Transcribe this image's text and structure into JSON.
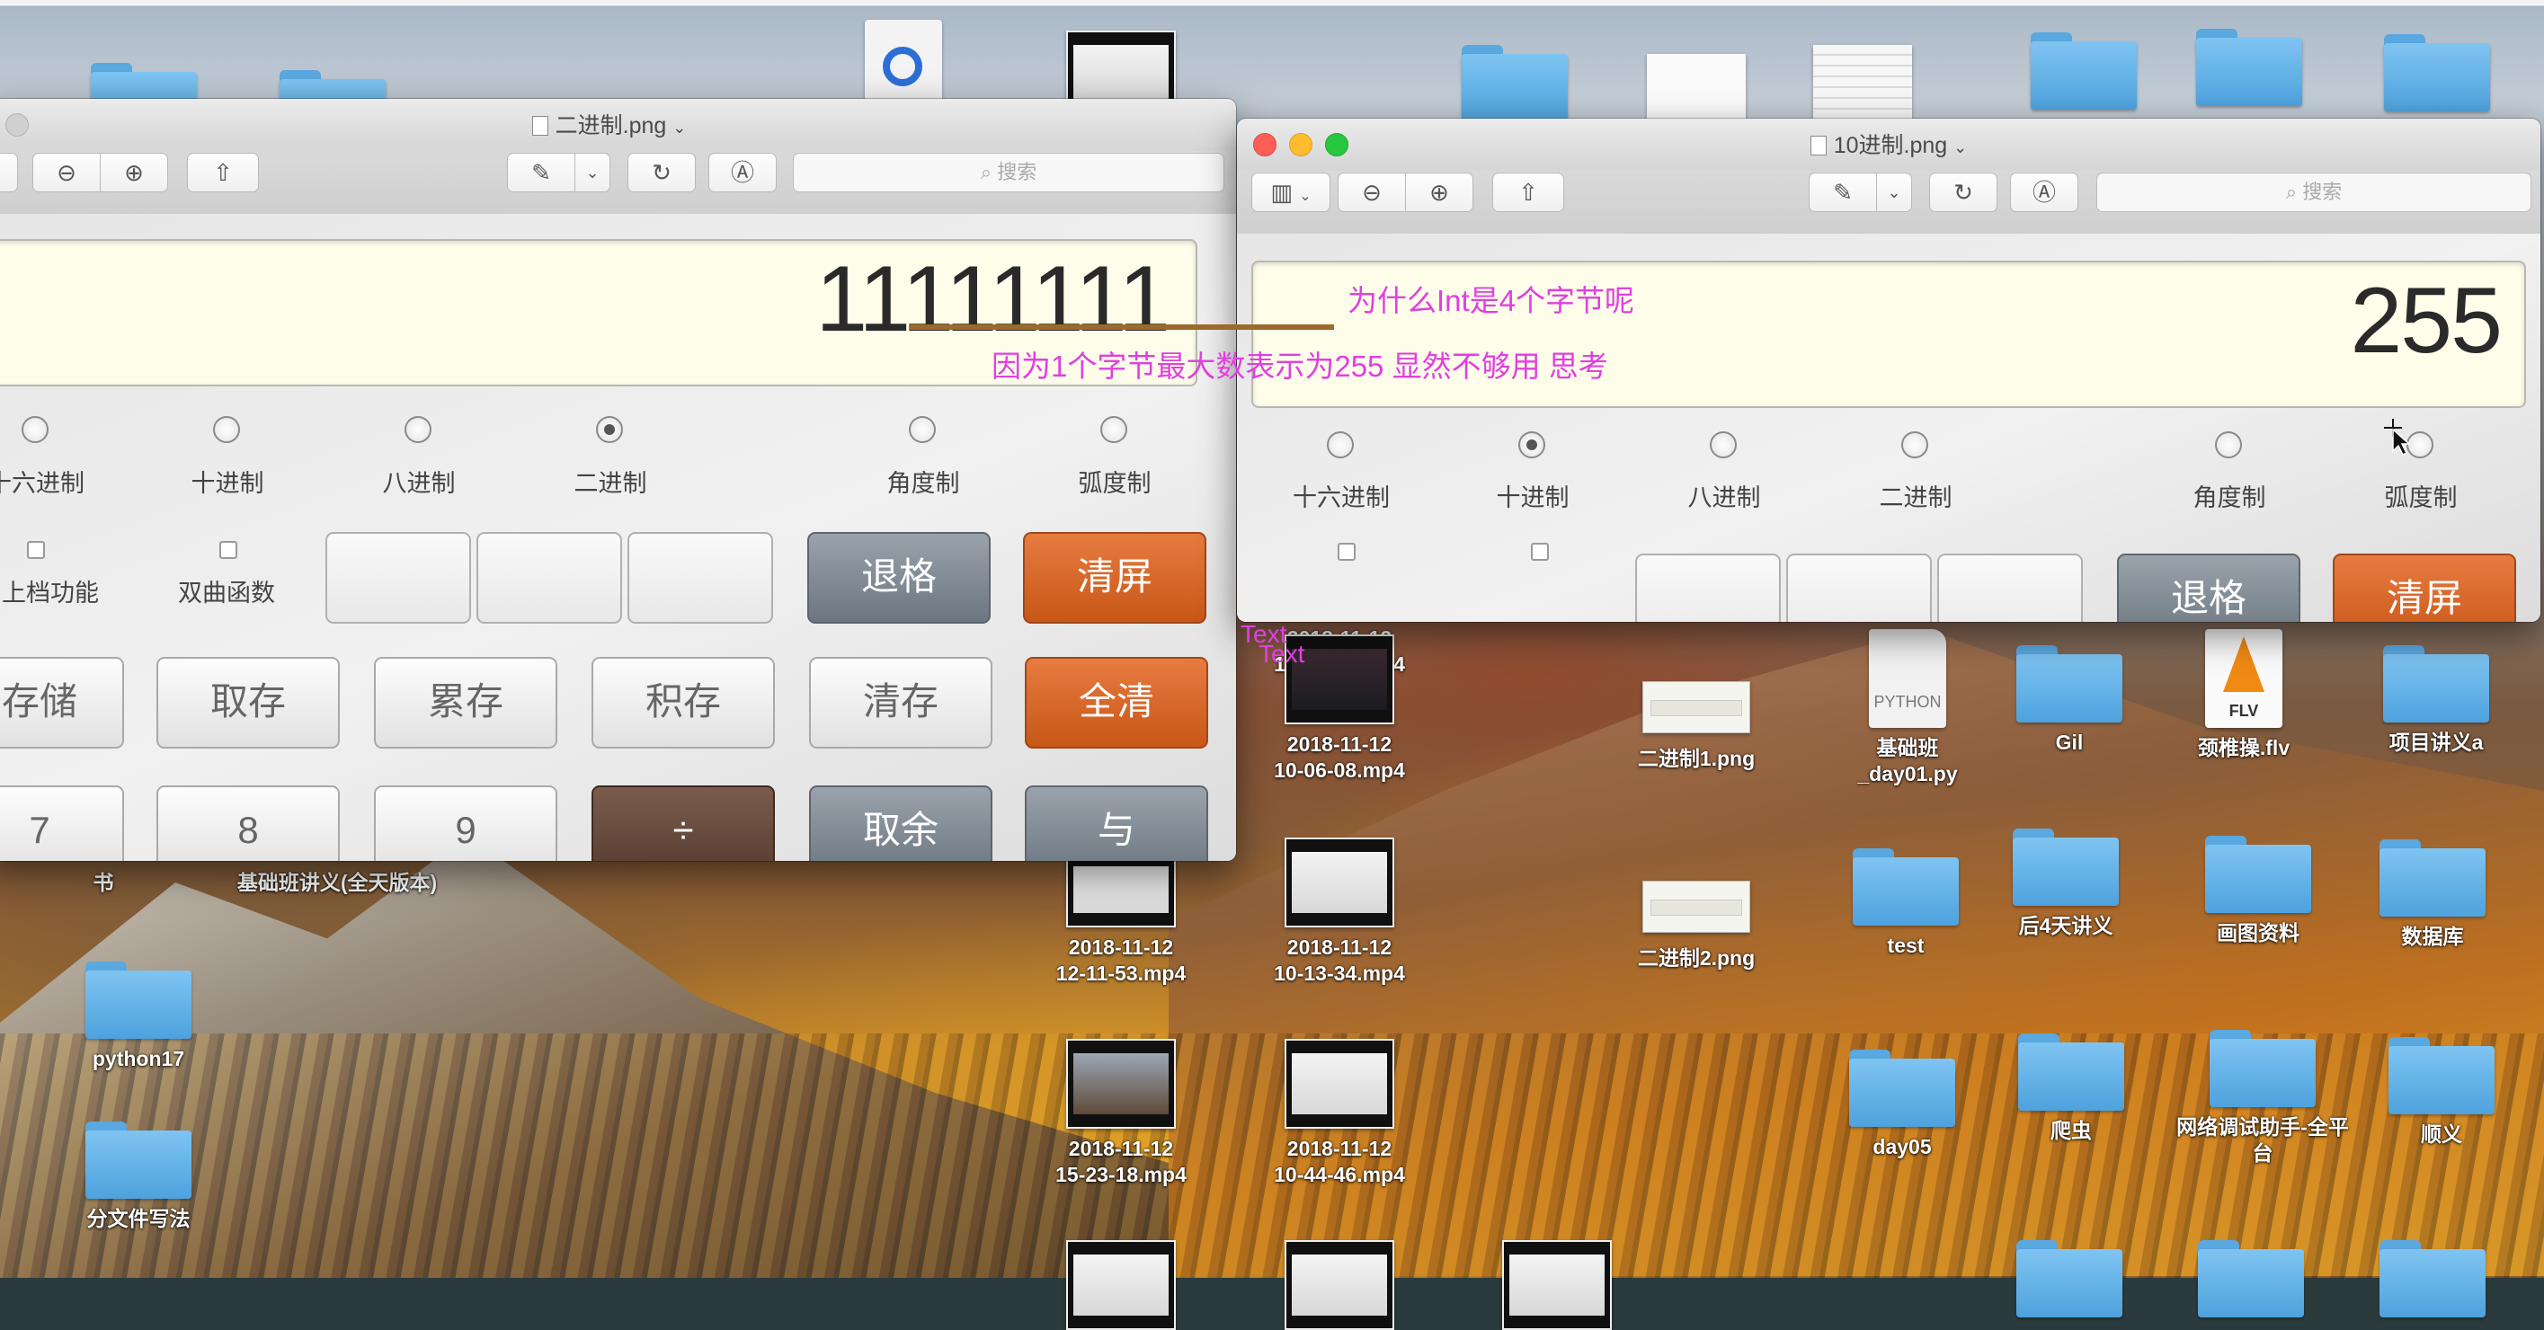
{
  "window_left": {
    "title": "二进制.png",
    "search_placeholder": "搜索",
    "display_value": "11111111",
    "radios": [
      "十六进制",
      "十进制",
      "八进制",
      "二进制",
      "角度制",
      "弧度制"
    ],
    "checkboxes": [
      "上档功能",
      "双曲函数"
    ],
    "keys": {
      "backspace": "退格",
      "clear_screen": "清屏",
      "store": "存储",
      "recall": "取存",
      "accumulate": "累存",
      "multiply_store": "积存",
      "clear_memory": "清存",
      "all_clear": "全清",
      "seven": "7",
      "eight": "8",
      "nine": "9",
      "divide": "÷",
      "modulo": "取余",
      "and": "与"
    }
  },
  "window_right": {
    "title": "10进制.png",
    "search_placeholder": "搜索",
    "display_value": "255",
    "radios": [
      "十六进制",
      "十进制",
      "八进制",
      "二进制",
      "角度制",
      "弧度制"
    ],
    "keys": {
      "backspace": "退格",
      "clear_screen": "清屏"
    }
  },
  "annotations": {
    "question": "为什么Int是4个字节呢",
    "answer": "因为1个字节最大数表示为255 显然不够用 思考",
    "text_a": "Text",
    "text_b": "Text"
  },
  "desktop_icons": {
    "vid_top_a_date": "2018-11-12",
    "vid_top_a_time": "10-01-08.mp4",
    "vid_1_date": "2018-11-12",
    "vid_1_time": "10-06-08.mp4",
    "vid_2_date": "2018-11-12",
    "vid_2_time": "12-11-53.mp4",
    "vid_3_date": "2018-11-12",
    "vid_3_time": "10-13-34.mp4",
    "vid_4_date": "2018-11-12",
    "vid_4_time": "15-23-18.mp4",
    "vid_5_date": "2018-11-12",
    "vid_5_time": "10-44-46.mp4",
    "png1": "二进制1.png",
    "png2": "二进制2.png",
    "py_file": "基础班_day01.py",
    "py_badge": "PYTHON",
    "gil": "Gil",
    "flv_file": "颈椎操.flv",
    "flv_badge": "FLV",
    "project_notes": "项目讲义a",
    "test": "test",
    "last4": "后4天讲义",
    "drawing": "画图资料",
    "database": "数据库",
    "day05": "day05",
    "crawler": "爬虫",
    "net_tool": "网络调试助手-全平台",
    "shunyi": "顺义",
    "basic_notes": "基础班讲义(全天版本)",
    "left_partial": "书",
    "python17": "python17",
    "file_split": "分文件写法"
  }
}
